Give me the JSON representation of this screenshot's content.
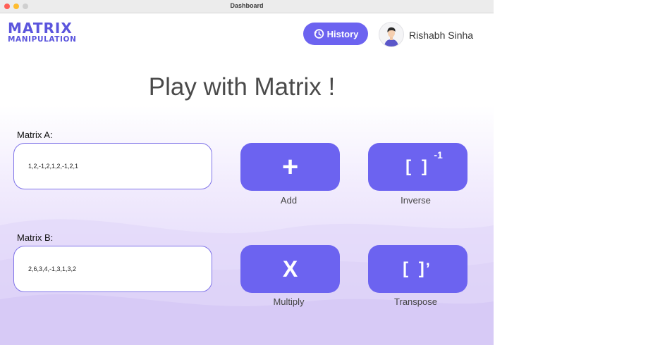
{
  "window": {
    "title": "Dashboard"
  },
  "logo": {
    "line1": "MATRIX",
    "line2": "MANIPULATION"
  },
  "header": {
    "history_label": "History",
    "user_name": "Rishabh Sinha"
  },
  "main": {
    "heading": "Play with Matrix !",
    "matrix_a": {
      "label": "Matrix A:",
      "value": "1,2,-1,2,1,2,-1,2,1"
    },
    "matrix_b": {
      "label": "Matrix B:",
      "value": "2,6,3,4,-1,3,1,3,2"
    },
    "operations": {
      "add": {
        "symbol": "+",
        "label": "Add"
      },
      "inverse": {
        "symbol": "[ ]",
        "superscript": "-1",
        "label": "Inverse"
      },
      "multiply": {
        "symbol": "X",
        "label": "Multiply"
      },
      "transpose": {
        "symbol": "[ ]",
        "prime": "’",
        "label": "Transpose"
      }
    }
  },
  "colors": {
    "accent": "#6c63f0",
    "logo": "#5b55dd",
    "input_border": "#7f73e8",
    "background_gradient": "#d9cdf7"
  }
}
